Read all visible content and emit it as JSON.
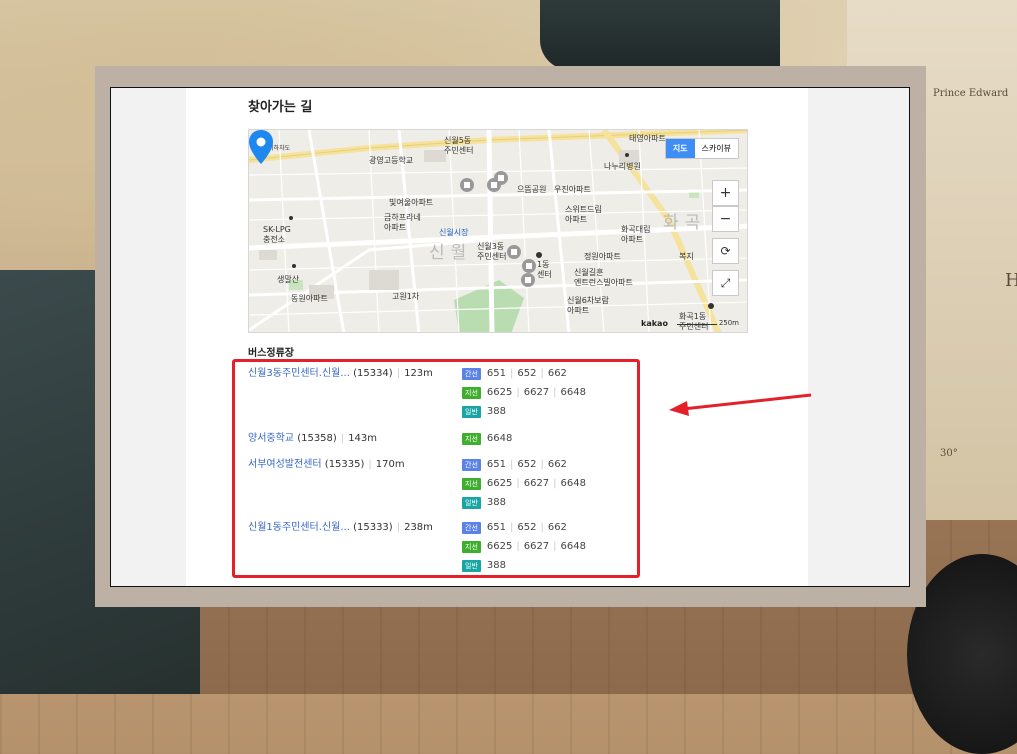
{
  "page": {
    "title": "찾아가는 길"
  },
  "map": {
    "toggle": [
      "지도",
      "스카이뷰"
    ],
    "zoom_in": "+",
    "zoom_out": "−",
    "refresh": "⟳",
    "expand": "⤢",
    "logo": "kakao",
    "scale_label": "250m",
    "labels": [
      "신월5동\n주민센터",
      "광영고등학교",
      "태영아파트",
      "나누리병원",
      "으뜸공원",
      "우진아파트",
      "빛여울아파트",
      "금하프라네\n아파트",
      "신월시장",
      "스위트드림\n아파트",
      "화곡대림\n아파트",
      "SK-LPG\n충전소",
      "신월3동\n주민센터",
      "1동\n센터",
      "정원아파트",
      "복지",
      "생말산",
      "신월길훈\n엔트런스빌아파트",
      "고원1차",
      "동원아파트",
      "신월6차보람\n아파트",
      "화곡1동\n주민센터",
      "고원지하차도"
    ],
    "watermarks": [
      "신월",
      "화곡"
    ]
  },
  "bus": {
    "section_title": "버스정류장",
    "stops": [
      {
        "name": "신월3동주민센터.신월...",
        "id": "(15334)",
        "distance": "123m",
        "routes": [
          {
            "type": "간선",
            "color": "#5b82e6",
            "numbers": [
              "651",
              "652",
              "662"
            ]
          },
          {
            "type": "지선",
            "color": "#3fae2f",
            "numbers": [
              "6625",
              "6627",
              "6648"
            ]
          },
          {
            "type": "일반",
            "color": "#19a5a3",
            "numbers": [
              "388"
            ]
          }
        ]
      },
      {
        "name": "양서중학교",
        "id": "(15358)",
        "distance": "143m",
        "routes": [
          {
            "type": "지선",
            "color": "#3fae2f",
            "numbers": [
              "6648"
            ]
          }
        ]
      },
      {
        "name": "서부여성발전센터",
        "id": "(15335)",
        "distance": "170m",
        "routes": [
          {
            "type": "간선",
            "color": "#5b82e6",
            "numbers": [
              "651",
              "652",
              "662"
            ]
          },
          {
            "type": "지선",
            "color": "#3fae2f",
            "numbers": [
              "6625",
              "6627",
              "6648"
            ]
          },
          {
            "type": "일반",
            "color": "#19a5a3",
            "numbers": [
              "388"
            ]
          }
        ]
      },
      {
        "name": "신월1동주민센터.신월...",
        "id": "(15333)",
        "distance": "238m",
        "routes": [
          {
            "type": "간선",
            "color": "#5b82e6",
            "numbers": [
              "651",
              "652",
              "662"
            ]
          },
          {
            "type": "지선",
            "color": "#3fae2f",
            "numbers": [
              "6625",
              "6627",
              "6648"
            ]
          },
          {
            "type": "일반",
            "color": "#19a5a3",
            "numbers": [
              "388"
            ]
          }
        ]
      }
    ]
  },
  "background": {
    "labels": [
      "Prince Edward",
      "H",
      "30°"
    ]
  },
  "annotation": {
    "box_color": "#e4202a",
    "arrow_color": "#e4202a"
  }
}
